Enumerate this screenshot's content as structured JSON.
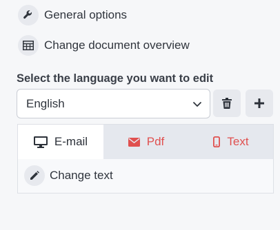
{
  "menu": {
    "general_options": "General options",
    "change_document_overview": "Change document overview"
  },
  "language": {
    "section_title": "Select the language you want to edit",
    "selected": "English"
  },
  "tabs": [
    {
      "label": "E-mail",
      "icon": "monitor-icon",
      "active": true
    },
    {
      "label": "Pdf",
      "icon": "envelope-icon",
      "active": false
    },
    {
      "label": "Text",
      "icon": "mobile-icon",
      "active": false
    }
  ],
  "actions": {
    "change_text": "Change text"
  },
  "colors": {
    "accent_red": "#e0504f",
    "tab_bar": "#e5e8ee",
    "icon_bg": "#e7e9ee"
  }
}
